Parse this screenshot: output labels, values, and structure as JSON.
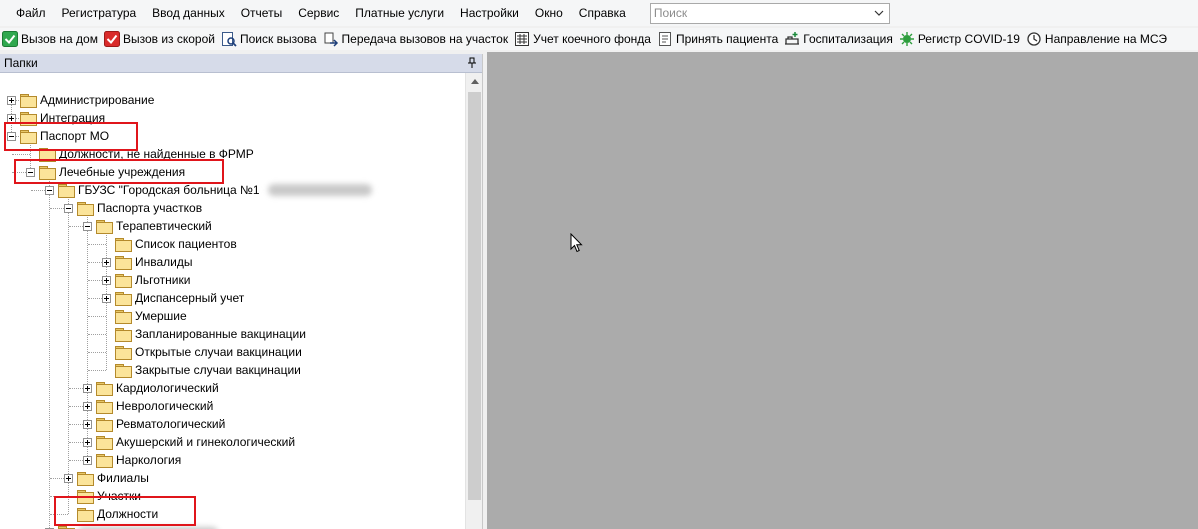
{
  "menu": [
    "Файл",
    "Регистратура",
    "Ввод данных",
    "Отчеты",
    "Сервис",
    "Платные услуги",
    "Настройки",
    "Окно",
    "Справка"
  ],
  "search": {
    "placeholder": "Поиск",
    "value": ""
  },
  "toolbar": [
    {
      "label": "Вызов на дом",
      "icon": "green-check-icon"
    },
    {
      "label": "Вызов из скорой",
      "icon": "red-check-icon"
    },
    {
      "label": "Поиск вызова",
      "icon": "search-document-icon"
    },
    {
      "label": "Передача вызовов на участок",
      "icon": "transfer-icon"
    },
    {
      "label": "Учет коечного фонда",
      "icon": "hospital-bed-icon"
    },
    {
      "label": "Принять пациента",
      "icon": "receive-patient-icon"
    },
    {
      "label": "Госпитализация",
      "icon": "hospitalization-icon"
    },
    {
      "label": "Регистр COVID-19",
      "icon": "virus-icon"
    },
    {
      "label": "Направление на МСЭ",
      "icon": "referral-icon"
    }
  ],
  "panel": {
    "title": "Папки"
  },
  "tree": [
    {
      "label": "Администрирование",
      "level": 0,
      "expander": "plus"
    },
    {
      "label": "Интеграция",
      "level": 0,
      "expander": "plus"
    },
    {
      "label": "Паспорт МО",
      "level": 0,
      "expander": "minus"
    },
    {
      "label": "Должности, не найденные в ФРМР",
      "level": 1,
      "expander": "none"
    },
    {
      "label": "Лечебные учреждения",
      "level": 1,
      "expander": "minus"
    },
    {
      "label": "ГБУЗС \"Городская больница №1",
      "level": 2,
      "expander": "minus"
    },
    {
      "label": "Паспорта участков",
      "level": 3,
      "expander": "minus"
    },
    {
      "label": "Терапевтический",
      "level": 4,
      "expander": "minus"
    },
    {
      "label": "Список пациентов",
      "level": 5,
      "expander": "none"
    },
    {
      "label": "Инвалиды",
      "level": 5,
      "expander": "plus"
    },
    {
      "label": "Льготники",
      "level": 5,
      "expander": "plus"
    },
    {
      "label": "Диспансерный учет",
      "level": 5,
      "expander": "plus"
    },
    {
      "label": "Умершие",
      "level": 5,
      "expander": "none"
    },
    {
      "label": "Запланированные вакцинации",
      "level": 5,
      "expander": "none"
    },
    {
      "label": "Открытые случаи вакцинации",
      "level": 5,
      "expander": "none"
    },
    {
      "label": "Закрытые случаи вакцинации",
      "level": 5,
      "expander": "none"
    },
    {
      "label": "Кардиологический",
      "level": 4,
      "expander": "plus"
    },
    {
      "label": "Неврологический",
      "level": 4,
      "expander": "plus"
    },
    {
      "label": "Ревматологический",
      "level": 4,
      "expander": "plus"
    },
    {
      "label": "Акушерский и гинекологический",
      "level": 4,
      "expander": "plus"
    },
    {
      "label": "Наркология",
      "level": 4,
      "expander": "plus"
    },
    {
      "label": "Филиалы",
      "level": 3,
      "expander": "plus"
    },
    {
      "label": "Участки",
      "level": 3,
      "expander": "none"
    },
    {
      "label": "Должности",
      "level": 3,
      "expander": "none"
    },
    {
      "label": "",
      "level": 2,
      "expander": "plus"
    }
  ],
  "colors": {
    "highlight": "#e0151b",
    "workspace": "#ababab",
    "panel_header": "#d6dbe9"
  }
}
